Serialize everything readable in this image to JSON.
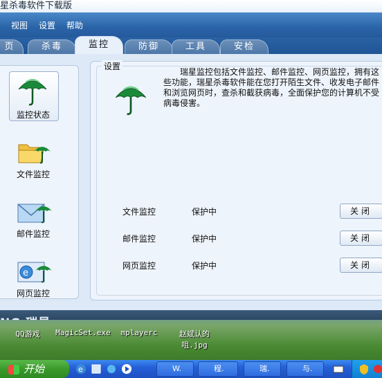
{
  "window": {
    "title": "星杀毒软件下载版"
  },
  "menu": [
    "视图",
    "设置",
    "帮助"
  ],
  "tabs": [
    "页",
    "杀毒",
    "监控",
    "防御",
    "工具",
    "安检"
  ],
  "active_tab": "监控",
  "sidebar": [
    {
      "label": "监控状态",
      "icon": "umbrella-icon",
      "selected": true
    },
    {
      "label": "文件监控",
      "icon": "folder-umbrella-icon",
      "selected": false
    },
    {
      "label": "邮件监控",
      "icon": "mail-umbrella-icon",
      "selected": false
    },
    {
      "label": "网页监控",
      "icon": "web-umbrella-icon",
      "selected": false
    }
  ],
  "settings": {
    "title": "设置",
    "description": "瑞星监控包括文件监控、邮件监控、网页监控，拥有这些功能，瑞星杀毒软件能在您打开陌生文件、收发电子邮件和浏览网页时，查杀和截获病毒，全面保护您的计算机不受病毒侵害。",
    "rows": [
      {
        "name": "文件监控",
        "status": "保护中",
        "button": "关闭"
      },
      {
        "name": "邮件监控",
        "status": "保护中",
        "button": "关闭"
      },
      {
        "name": "网页监控",
        "status": "保护中",
        "button": "关闭"
      }
    ]
  },
  "brand": {
    "text": "NG 瑞星"
  },
  "desktop_icons": [
    "QQ游戏",
    "MagicSet.exe",
    "mplayerc",
    "赵斌认的咀.jpg"
  ],
  "taskbar": {
    "start": "开始",
    "tasks": [
      "W.",
      "程.",
      "瑞.",
      "与."
    ]
  },
  "colors": {
    "umbrella": "#1a8a3a",
    "accent": "#2a64a8"
  }
}
